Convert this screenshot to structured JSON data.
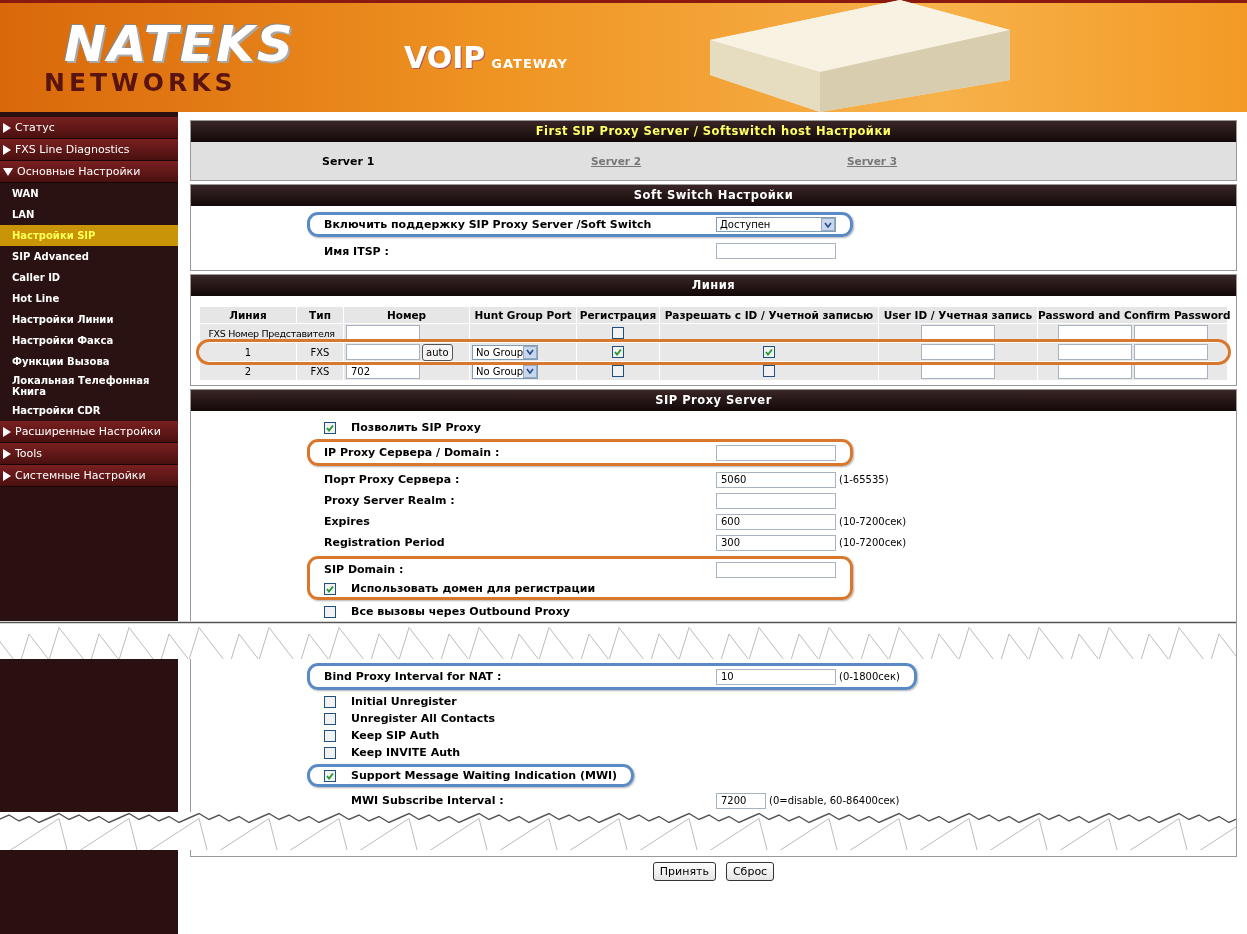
{
  "header": {
    "logo_top": "NATEKS",
    "logo_bottom": "NETWORKS",
    "product": "VOIP",
    "product_sub": "GATEWAY"
  },
  "sidebar": {
    "items": [
      {
        "label": "Статус",
        "expanded": false
      },
      {
        "label": "FXS Line Diagnostics",
        "expanded": false
      },
      {
        "label": "Основные Настройки",
        "expanded": true,
        "children": [
          {
            "label": "WAN",
            "selected": false
          },
          {
            "label": "LAN",
            "selected": false
          },
          {
            "label": "Настройки SIP",
            "selected": true
          },
          {
            "label": "SIP Advanced",
            "selected": false
          },
          {
            "label": "Caller ID",
            "selected": false
          },
          {
            "label": "Hot Line",
            "selected": false
          },
          {
            "label": "Настройки Линии",
            "selected": false
          },
          {
            "label": "Настройки Факса",
            "selected": false
          },
          {
            "label": "Функции Вызова",
            "selected": false
          },
          {
            "label": "Локальная Телефонная Книга",
            "selected": false
          },
          {
            "label": "Настройки CDR",
            "selected": false
          }
        ]
      },
      {
        "label": "Расширенные Настройки",
        "expanded": false
      },
      {
        "label": "Tools",
        "expanded": false
      },
      {
        "label": "Системные Настройки",
        "expanded": false
      }
    ]
  },
  "page_title": "First SIP Proxy Server / Softswitch host Настройки",
  "server_tabs": [
    {
      "label": "Server 1",
      "selected": true
    },
    {
      "label": "Server 2",
      "selected": false
    },
    {
      "label": "Server 3",
      "selected": false
    }
  ],
  "soft_switch": {
    "title": "Soft Switch Настройки",
    "rows": [
      {
        "kind": "select",
        "label": "Включить поддержку SIP Proxy Server /Soft Switch",
        "value": "Доступен",
        "color": "#5a8ac6"
      },
      {
        "kind": "field",
        "label": "Имя ITSP :"
      }
    ]
  },
  "line": {
    "title": "Линия",
    "columns": [
      "Линия",
      "Тип",
      "Номер",
      "Hunt Group Port",
      "Регистрация",
      "Разрешать с ID / Учетной записью",
      "User ID / Учетная запись",
      "Password and Confirm Password"
    ],
    "rows": [
      {
        "kind": "representative",
        "line": "FXS Номер Представителя",
        "registration": false
      },
      {
        "kind": "line",
        "line": "1",
        "type": "FXS",
        "auto_button": "auto",
        "hunt_group": "No Group",
        "registration": true,
        "allow_id": true,
        "color": "#d9782d"
      },
      {
        "kind": "line",
        "line": "2",
        "type": "FXS",
        "number": "702",
        "hunt_group": "No Group",
        "registration": false,
        "allow_id": false
      }
    ]
  },
  "sip_proxy": {
    "title": "SIP Proxy Server",
    "blocks": [
      {
        "items": [
          {
            "kind": "checkbox",
            "label": "Позволить SIP Proxy",
            "checked": true
          }
        ]
      },
      {
        "color": "#d9782d",
        "items": [
          {
            "kind": "field",
            "label": "IP Proxy Сервера / Domain :"
          }
        ]
      },
      {
        "items": [
          {
            "kind": "field",
            "label": "Порт Proxy Сервера :",
            "value": "5060",
            "hint": "(1-65535)"
          },
          {
            "kind": "field",
            "label": "Proxy Server Realm :"
          },
          {
            "kind": "field",
            "label": "Expires",
            "value": "600",
            "hint": "(10-7200сек)"
          },
          {
            "kind": "field",
            "label": "Registration Period",
            "value": "300",
            "hint": "(10-7200сек)"
          }
        ]
      },
      {
        "color": "#d9782d",
        "items": [
          {
            "kind": "field",
            "label": "SIP Domain :"
          },
          {
            "kind": "checkbox",
            "label": "Использовать домен для регистрации",
            "checked": true
          }
        ]
      },
      {
        "items": [
          {
            "kind": "checkbox",
            "label": "Все вызовы через Outbound Proxy",
            "checked": false
          },
          {
            "kind": "break"
          }
        ]
      },
      {
        "color": "#5a8ac6",
        "items": [
          {
            "kind": "field",
            "label": "Bind Proxy Interval for NAT :",
            "value": "10",
            "hint": "(0-1800сек)"
          }
        ]
      },
      {
        "items": [
          {
            "kind": "checkbox",
            "label": "Initial Unregister",
            "checked": false
          },
          {
            "kind": "checkbox",
            "label": "Unregister All Contacts",
            "checked": false
          },
          {
            "kind": "checkbox",
            "label": "Keep SIP Auth",
            "checked": false
          },
          {
            "kind": "checkbox",
            "label": "Keep INVITE Auth",
            "checked": false
          }
        ]
      },
      {
        "color": "#5a8ac6",
        "items": [
          {
            "kind": "checkbox",
            "label": "Support Message Waiting Indication (MWI)",
            "checked": true
          }
        ]
      },
      {
        "items": [
          {
            "kind": "subfield",
            "label": "MWI Subscribe Interval :",
            "value": "7200",
            "hint": "(0=disable, 60-86400сек)"
          },
          {
            "kind": "break"
          }
        ]
      }
    ]
  },
  "buttons": [
    "Принять",
    "Сброс"
  ]
}
